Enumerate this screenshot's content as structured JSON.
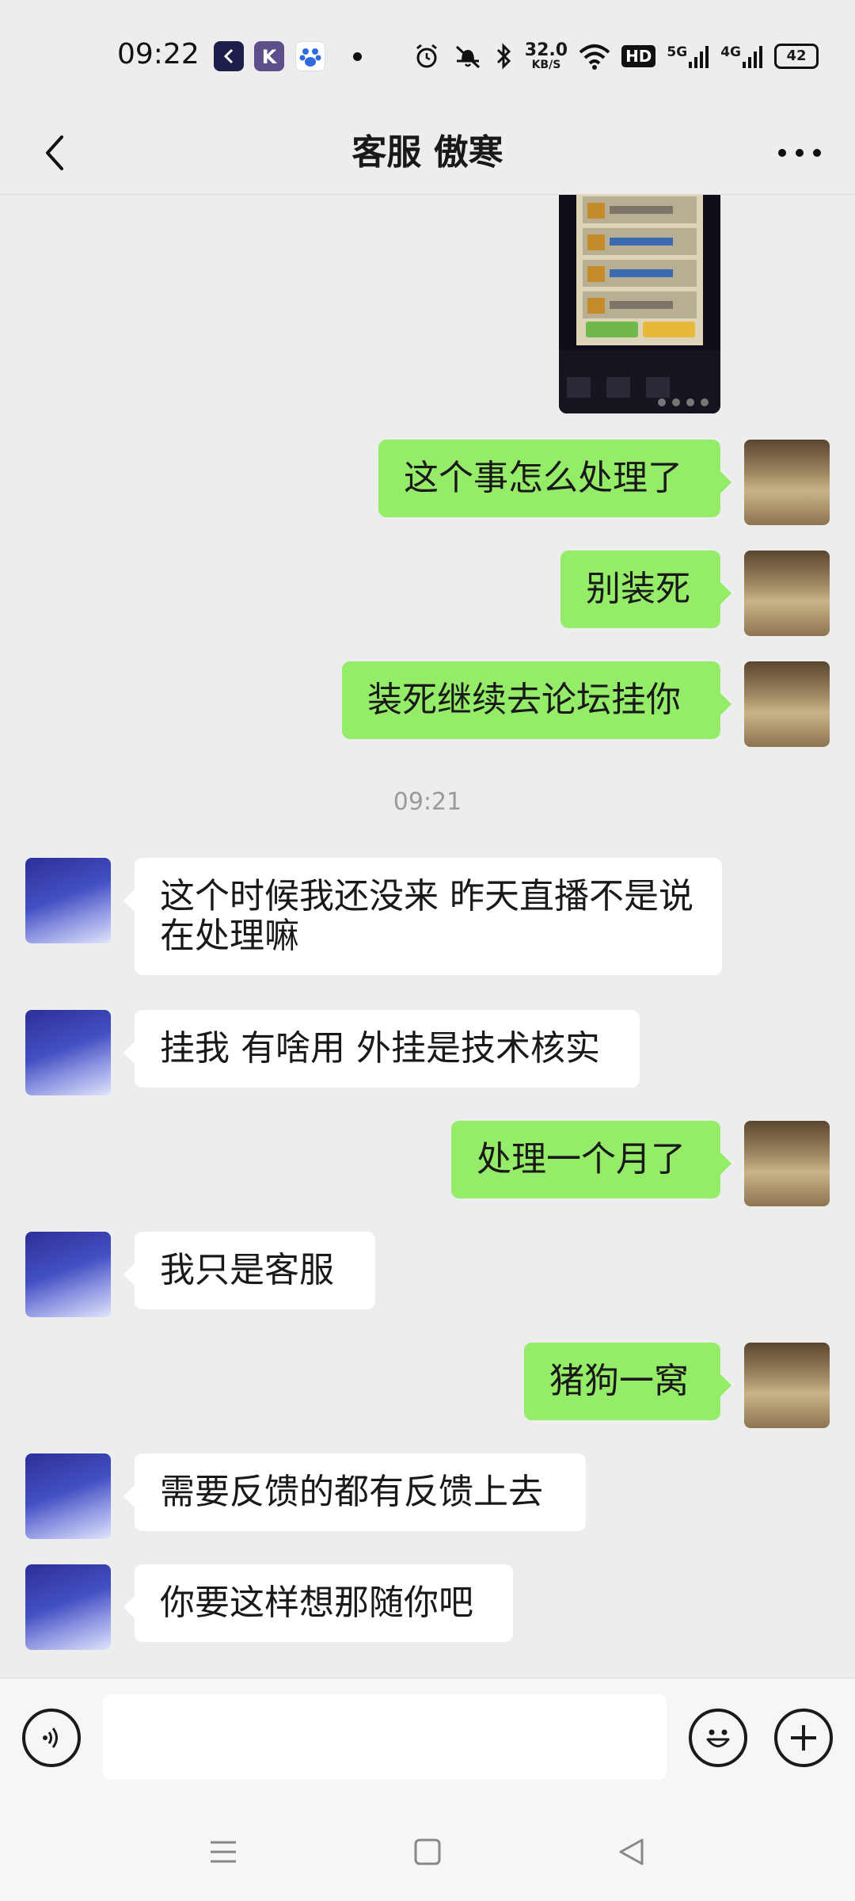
{
  "status_bar": {
    "time": "09:22",
    "apps": [
      "app-icon-dark",
      "app-icon-k",
      "baidu-icon"
    ],
    "net_speed_value": "32.0",
    "net_speed_unit": "KB/S",
    "hd_label": "HD",
    "sim1_label": "5G",
    "sim2_label": "4G",
    "battery": "42"
  },
  "header": {
    "title": "客服 傲寒"
  },
  "chat": {
    "messages": [
      {
        "side": "me",
        "text": "这个事怎么处理了"
      },
      {
        "side": "me",
        "text": "别装死"
      },
      {
        "side": "me",
        "text": "装死继续去论坛挂你"
      },
      {
        "side": "other",
        "text": "这个时候我还没来 昨天直播不是说在处理嘛"
      },
      {
        "side": "other",
        "text": "挂我 有啥用 外挂是技术核实"
      },
      {
        "side": "me",
        "text": "处理一个月了"
      },
      {
        "side": "other",
        "text": "我只是客服"
      },
      {
        "side": "me",
        "text": "猪狗一窝"
      },
      {
        "side": "other",
        "text": "需要反馈的都有反馈上去"
      },
      {
        "side": "other",
        "text": "你要这样想那随你吧"
      }
    ],
    "timestamp": "09:21"
  },
  "input": {
    "value": "",
    "placeholder": ""
  },
  "colors": {
    "bubble_me": "#95ec69",
    "bubble_other": "#ffffff",
    "background": "#ededed"
  }
}
